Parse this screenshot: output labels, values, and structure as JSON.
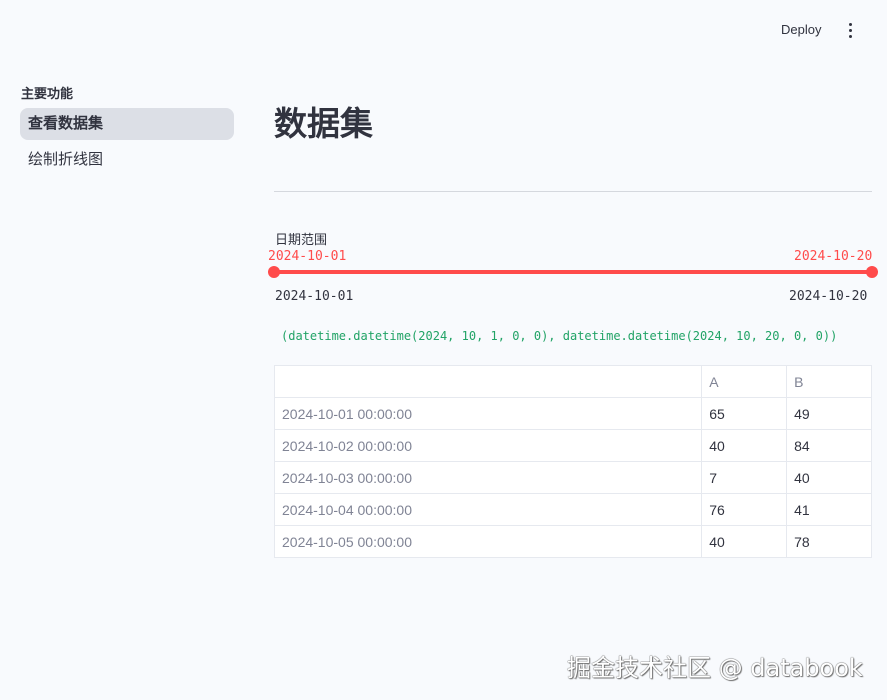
{
  "header": {
    "deploy_label": "Deploy",
    "menu_icon": "more-vertical-icon"
  },
  "sidebar": {
    "heading": "主要功能",
    "items": [
      {
        "label": "查看数据集",
        "active": true
      },
      {
        "label": "绘制折线图",
        "active": false
      }
    ]
  },
  "main": {
    "title": "数据集",
    "slider": {
      "label": "日期范围",
      "min": "2024-10-01",
      "max": "2024-10-20",
      "value_start": "2024-10-01",
      "value_end": "2024-10-20",
      "color": "#ff4b4b"
    },
    "output_text": "(datetime.datetime(2024, 10, 1, 0, 0), datetime.datetime(2024, 10, 20, 0, 0))",
    "table": {
      "columns": [
        "",
        "A",
        "B"
      ],
      "rows": [
        {
          "index": "2024-10-01 00:00:00",
          "A": "65",
          "B": "49"
        },
        {
          "index": "2024-10-02 00:00:00",
          "A": "40",
          "B": "84"
        },
        {
          "index": "2024-10-03 00:00:00",
          "A": "7",
          "B": "40"
        },
        {
          "index": "2024-10-04 00:00:00",
          "A": "76",
          "B": "41"
        },
        {
          "index": "2024-10-05 00:00:00",
          "A": "40",
          "B": "78"
        }
      ]
    }
  },
  "watermark": "掘金技术社区 @ databook"
}
